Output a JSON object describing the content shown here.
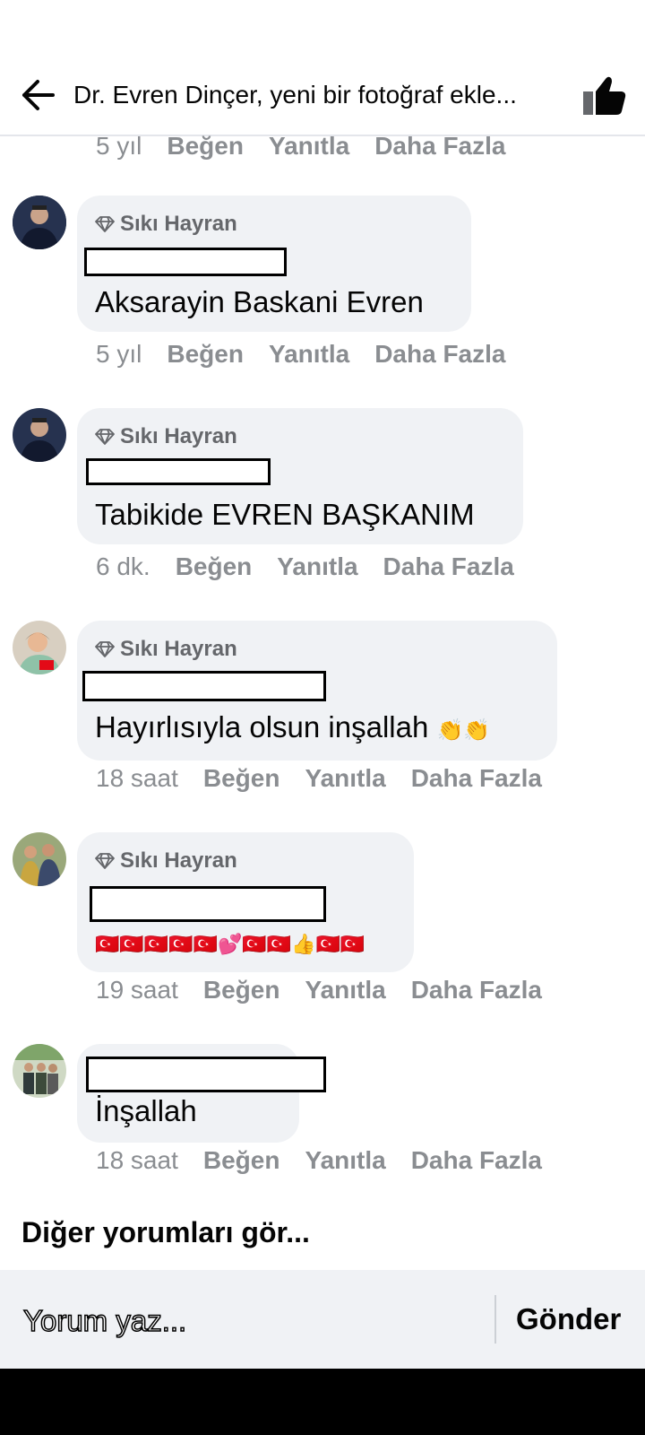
{
  "header": {
    "title": "Dr. Evren Dinçer, yeni bir fotoğraf ekle...",
    "back_icon": "arrow-left-icon",
    "like_icon": "thumbs-up-icon"
  },
  "actions": {
    "like": "Beğen",
    "reply": "Yanıtla",
    "more": "Daha Fazla"
  },
  "badge_label": "Sıkı Hayran",
  "top_meta": {
    "time": "5 yıl"
  },
  "comments": [
    {
      "badge": "Sıkı Hayran",
      "text": "Aksarayin Baskani Evren",
      "time": "5 yıl"
    },
    {
      "badge": "Sıkı Hayran",
      "text": "Tabikide EVREN BAŞKANIM",
      "time": "6 dk."
    },
    {
      "badge": "Sıkı Hayran",
      "text": "Hayırlısıyla olsun inşallah",
      "emoji": "👏👏",
      "time": "18 saat"
    },
    {
      "badge": "Sıkı Hayran",
      "text": "🇹🇷🇹🇷🇹🇷🇹🇷🇹🇷💕🇹🇷🇹🇷👍🇹🇷🇹🇷",
      "time": "19 saat"
    },
    {
      "text": "İnşallah",
      "time": "18 saat"
    }
  ],
  "more_comments": "Diğer yorumları gör...",
  "composer": {
    "placeholder": "Yorum yaz...",
    "send": "Gönder"
  },
  "colors": {
    "meta": "#8a8d91",
    "bubble": "#f0f2f5",
    "badge": "#65676b"
  }
}
